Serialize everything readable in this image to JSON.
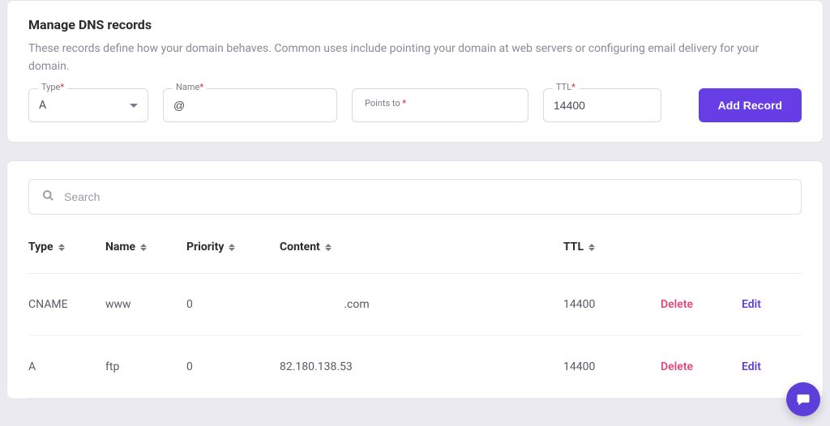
{
  "header": {
    "title": "Manage DNS records",
    "description": "These records define how your domain behaves. Common uses include pointing your domain at web servers or configuring email delivery for your domain."
  },
  "form": {
    "type_label": "Type",
    "type_value": "A",
    "name_label": "Name",
    "name_value": "@",
    "points_label": "Points to",
    "points_value": "",
    "ttl_label": "TTL",
    "ttl_value": "14400",
    "add_button": "Add Record"
  },
  "search": {
    "placeholder": "Search",
    "value": ""
  },
  "table": {
    "headers": {
      "type": "Type",
      "name": "Name",
      "priority": "Priority",
      "content": "Content",
      "ttl": "TTL"
    },
    "rows": [
      {
        "type": "CNAME",
        "name": "www",
        "priority": "0",
        "content": ".com",
        "ttl": "14400"
      },
      {
        "type": "A",
        "name": "ftp",
        "priority": "0",
        "content": "82.180.138.53",
        "ttl": "14400"
      }
    ],
    "delete_label": "Delete",
    "edit_label": "Edit"
  }
}
